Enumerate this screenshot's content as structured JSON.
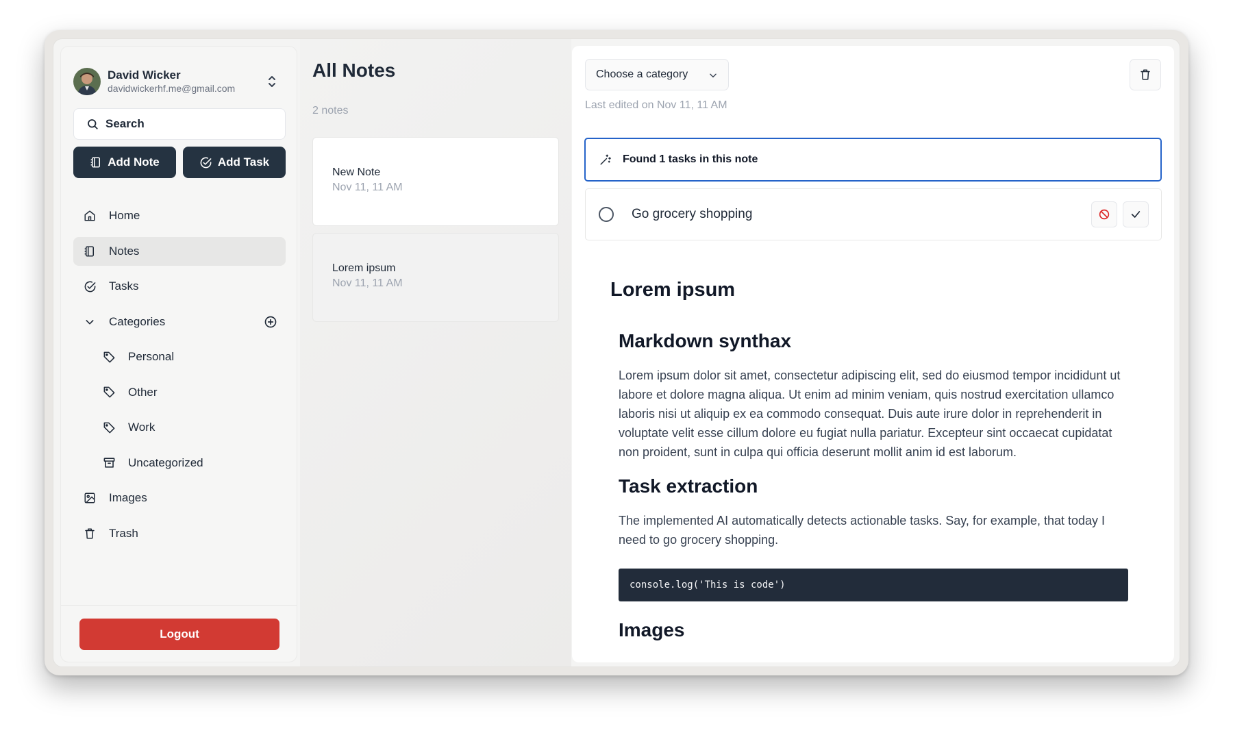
{
  "user": {
    "name": "David Wicker",
    "email": "davidwickerhf.me@gmail.com"
  },
  "search": {
    "label": "Search"
  },
  "actions": {
    "add_note": "Add Note",
    "add_task": "Add Task"
  },
  "nav": {
    "home": "Home",
    "notes": "Notes",
    "tasks": "Tasks",
    "categories": "Categories",
    "category_items": [
      "Personal",
      "Other",
      "Work",
      "Uncategorized"
    ],
    "images": "Images",
    "trash": "Trash"
  },
  "logout": "Logout",
  "notes_list": {
    "title": "All Notes",
    "count": "2 notes",
    "items": [
      {
        "name": "New Note",
        "date": "Nov 11, 11 AM"
      },
      {
        "name": "Lorem ipsum",
        "date": "Nov 11, 11 AM"
      }
    ]
  },
  "editor": {
    "category_placeholder": "Choose a category",
    "last_edited": "Last edited on Nov 11, 11 AM",
    "found_tasks": "Found 1 tasks in this note",
    "task": "Go grocery shopping",
    "doc_title": "Lorem ipsum",
    "h_markdown": "Markdown synthax",
    "p_markdown": "Lorem ipsum dolor sit amet, consectetur adipiscing elit, sed do eiusmod tempor incididunt ut labore et dolore magna aliqua. Ut enim ad minim veniam, quis nostrud exercitation ullamco laboris nisi ut aliquip ex ea commodo consequat. Duis aute irure dolor in reprehenderit in voluptate velit esse cillum dolore eu fugiat nulla pariatur. Excepteur sint occaecat cupidatat non proident, sunt in culpa qui officia deserunt mollit anim id est laborum.",
    "h_task": "Task extraction",
    "p_task": "The implemented AI automatically detects actionable tasks. Say, for example, that today I need to go grocery shopping.",
    "code": "console.log('This is code')",
    "h_images": "Images"
  },
  "colors": {
    "accent_blue": "#2563c9",
    "dark_button": "#253341",
    "logout_red": "#d23a33"
  }
}
